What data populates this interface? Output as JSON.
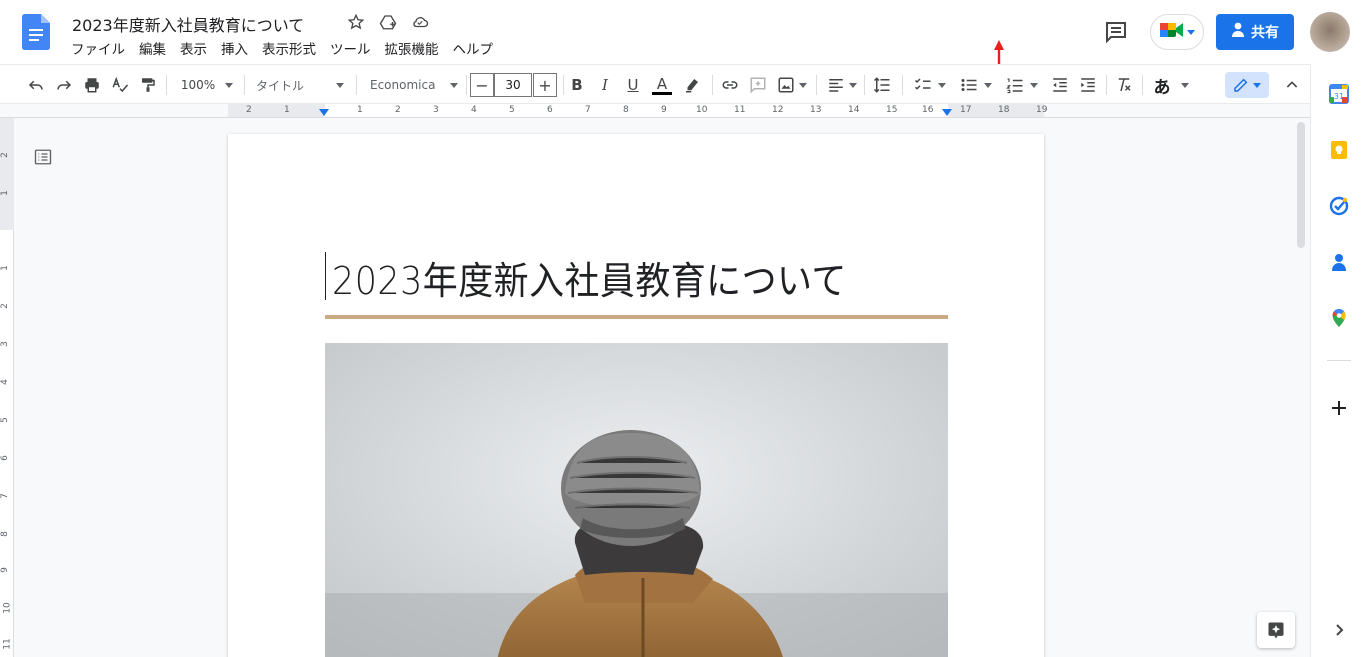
{
  "doc": {
    "title": "2023年度新入社員教育について"
  },
  "menu": [
    "ファイル",
    "編集",
    "表示",
    "挿入",
    "表示形式",
    "ツール",
    "拡張機能",
    "ヘルプ"
  ],
  "header": {
    "share_label": "共有"
  },
  "toolbar": {
    "zoom": "100%",
    "style": "タイトル",
    "font": "Economica",
    "font_size": "30",
    "input_tool": "あ"
  },
  "ruler": {
    "numbers": [
      "2",
      "1",
      "1",
      "2",
      "3",
      "4",
      "5",
      "6",
      "7",
      "8",
      "9",
      "10",
      "11",
      "12",
      "13",
      "14",
      "15",
      "16",
      "17",
      "18",
      "19"
    ]
  },
  "vruler": {
    "numbers": [
      "2",
      "1",
      "1",
      "2",
      "3",
      "4",
      "5",
      "6",
      "7",
      "8",
      "9",
      "10",
      "11"
    ]
  },
  "page": {
    "heading": "2023年度新入社員教育について"
  },
  "colors": {
    "accent": "#1a73e8",
    "heading_rule": "#c9a986"
  }
}
